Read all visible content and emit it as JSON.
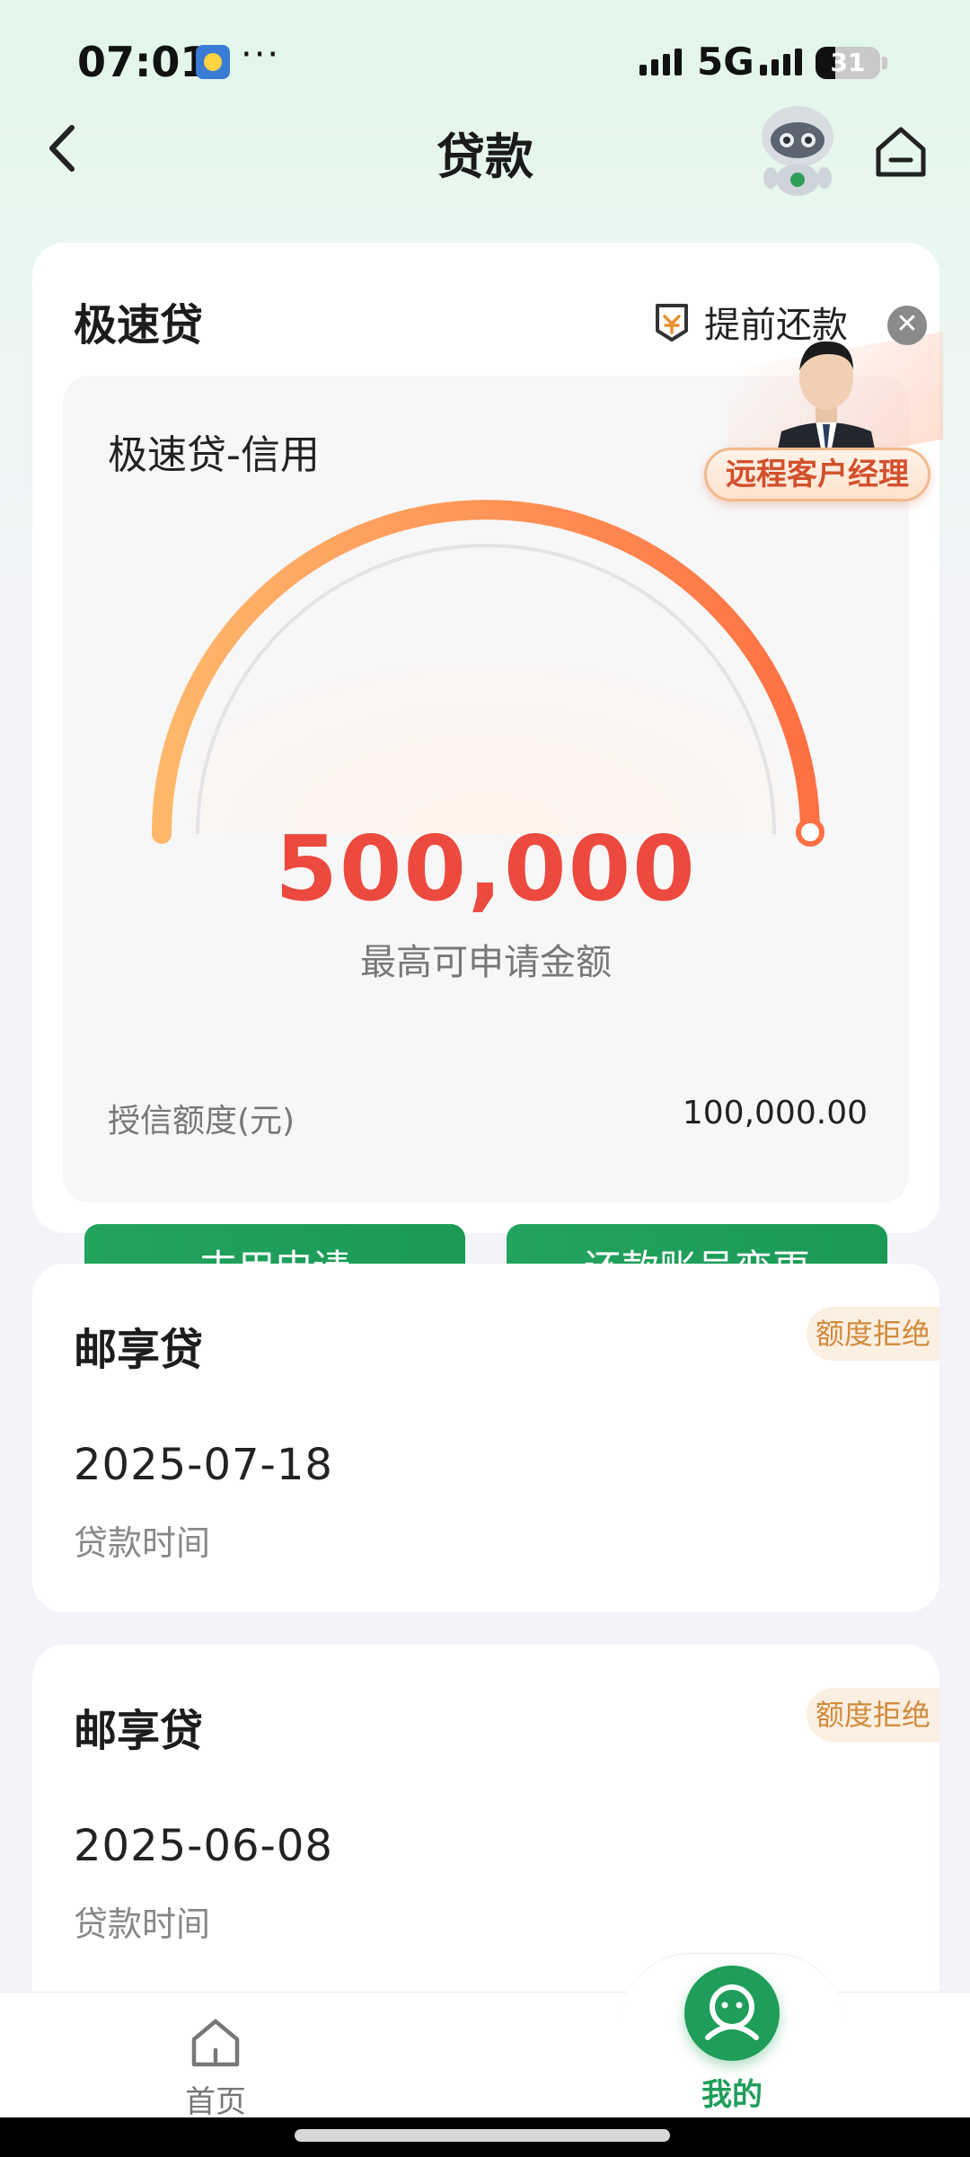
{
  "status_bar": {
    "time": "07:01",
    "dots": "···",
    "network": "5G",
    "battery": "31",
    "battery_level_percent": 31
  },
  "nav": {
    "title": "贷款",
    "back_icon": "chevron-left-icon",
    "assistant_icon": "robot-icon",
    "home_icon": "home-icon"
  },
  "primary_card": {
    "title": "极速贷",
    "prepay_label": "提前还款",
    "product_name": "极速贷-信用",
    "max_amount": "500,000",
    "max_amount_label": "最高可申请金额",
    "credit_label": "授信额度(元)",
    "credit_value": "100,000.00",
    "apply_button": "支用申请",
    "change_account_button": "还款账号变更"
  },
  "remote_manager": {
    "label": "远程客户经理",
    "close": "✕"
  },
  "loans": [
    {
      "title": "邮享贷",
      "status": "额度拒绝",
      "date": "2025-07-18",
      "date_label": "贷款时间"
    },
    {
      "title": "邮享贷",
      "status": "额度拒绝",
      "date": "2025-06-08",
      "date_label": "贷款时间"
    }
  ],
  "tabbar": {
    "home_label": "首页",
    "mine_label": "我的"
  },
  "colors": {
    "brand_green": "#1f9d5a",
    "amount_red": "#ec4a3e",
    "gauge_start": "#ffb86b",
    "gauge_end": "#ff7043",
    "badge_text": "#d28b3a"
  }
}
